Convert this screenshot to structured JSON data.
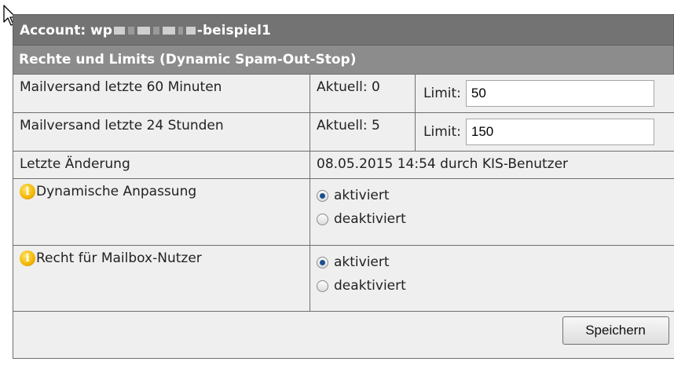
{
  "header": {
    "account_label": "Account: wp",
    "account_suffix": "-beispiel1",
    "section_title": "Rechte und Limits (Dynamic Spam-Out-Stop)"
  },
  "rows": [
    {
      "label": "Mailversand letzte 60 Minuten",
      "current": "Aktuell: 0",
      "limit_label": "Limit:",
      "limit_value": "50"
    },
    {
      "label": "Mailversand letzte 24 Stunden",
      "current": "Aktuell: 5",
      "limit_label": "Limit:",
      "limit_value": "150"
    }
  ],
  "last_change": {
    "label": "Letzte Änderung",
    "value": "08.05.2015 14:54 durch KIS-Benutzer"
  },
  "settings": [
    {
      "label": "Dynamische Anpassung",
      "icon": "info-icon",
      "options": [
        "aktiviert",
        "deaktiviert"
      ],
      "selected": "aktiviert"
    },
    {
      "label": "Recht für Mailbox-Nutzer",
      "icon": "info-icon",
      "options": [
        "aktiviert",
        "deaktiviert"
      ],
      "selected": "aktiviert"
    }
  ],
  "actions": {
    "save_label": "Speichern"
  },
  "colors": {
    "title_bar": "#737373",
    "section_bar": "#8c8c8c",
    "table_bg": "#efefef",
    "radio_checked": "#1a4f8f",
    "info_icon": "#f2b600"
  }
}
